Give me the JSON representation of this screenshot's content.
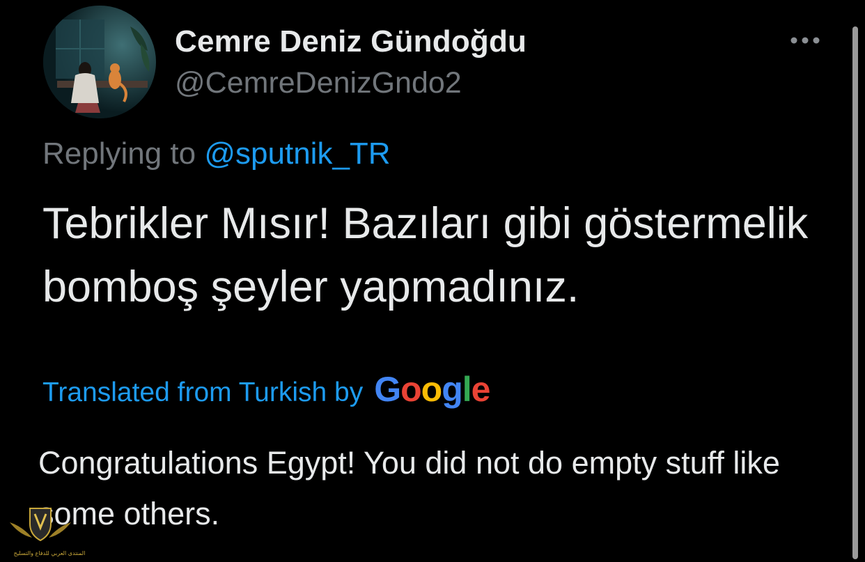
{
  "tweet": {
    "author": {
      "display_name": "Cemre Deniz Gündoğdu",
      "handle": "@CemreDenizGndo2"
    },
    "more_icon": "more-horizontal-icon",
    "reply": {
      "prefix": "Replying to ",
      "mention": "@sputnik_TR"
    },
    "text": "Tebrikler Mısır! Bazıları gibi göstermelik bomboş şeyler yapmadınız.",
    "translation": {
      "label": "Translated from Turkish by",
      "provider": "Google",
      "text": "Congratulations Egypt! You did not do empty stuff like some others."
    }
  },
  "watermark": {
    "caption": "المنتدى العربي للدفاع والتسليح"
  },
  "colors": {
    "background": "#000000",
    "primary_text": "#e7e9ea",
    "secondary_text": "#71767b",
    "link": "#1d9bf0"
  }
}
